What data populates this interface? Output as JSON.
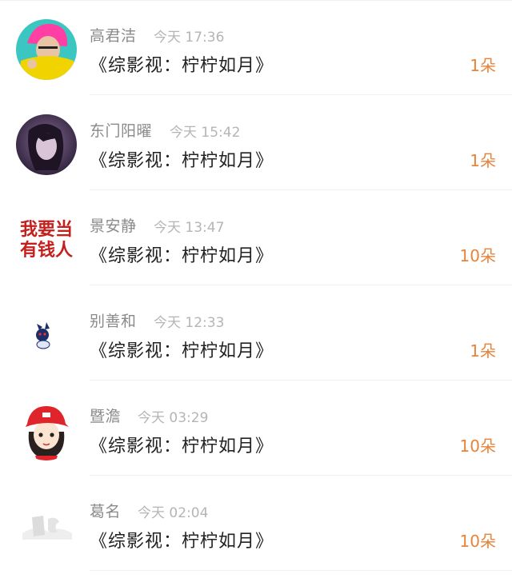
{
  "gift_list": [
    {
      "user": "高君洁",
      "time": "今天 17:36",
      "gift": "《综影视：柠柠如月》",
      "count": "1朵",
      "avatar_icon": "pink-hat-portrait-icon"
    },
    {
      "user": "东门阳曜",
      "time": "今天 15:42",
      "gift": "《综影视：柠柠如月》",
      "count": "1朵",
      "avatar_icon": "dark-portrait-icon"
    },
    {
      "user": "景安静",
      "time": "今天 13:47",
      "gift": "《综影视：柠柠如月》",
      "count": "10朵",
      "avatar_icon": "text-sticker-avatar-icon",
      "avatar_text": [
        "我要当",
        "有钱人"
      ]
    },
    {
      "user": "别善和",
      "time": "今天 12:33",
      "gift": "《综影视：柠柠如月》",
      "count": "1朵",
      "avatar_icon": "cartoon-devil-icon"
    },
    {
      "user": "暨澹",
      "time": "今天 03:29",
      "gift": "《综影视：柠柠如月》",
      "count": "10朵",
      "avatar_icon": "cartoon-red-cap-girl-icon"
    },
    {
      "user": "葛名",
      "time": "今天 02:04",
      "gift": "《综影视：柠柠如月》",
      "count": "10朵",
      "avatar_icon": "faded-logo-avatar-icon"
    }
  ],
  "colors": {
    "count_accent": "#e8833a",
    "username": "#8a8a8a",
    "timestamp": "#b5b5b5",
    "gift_text": "#222222"
  }
}
